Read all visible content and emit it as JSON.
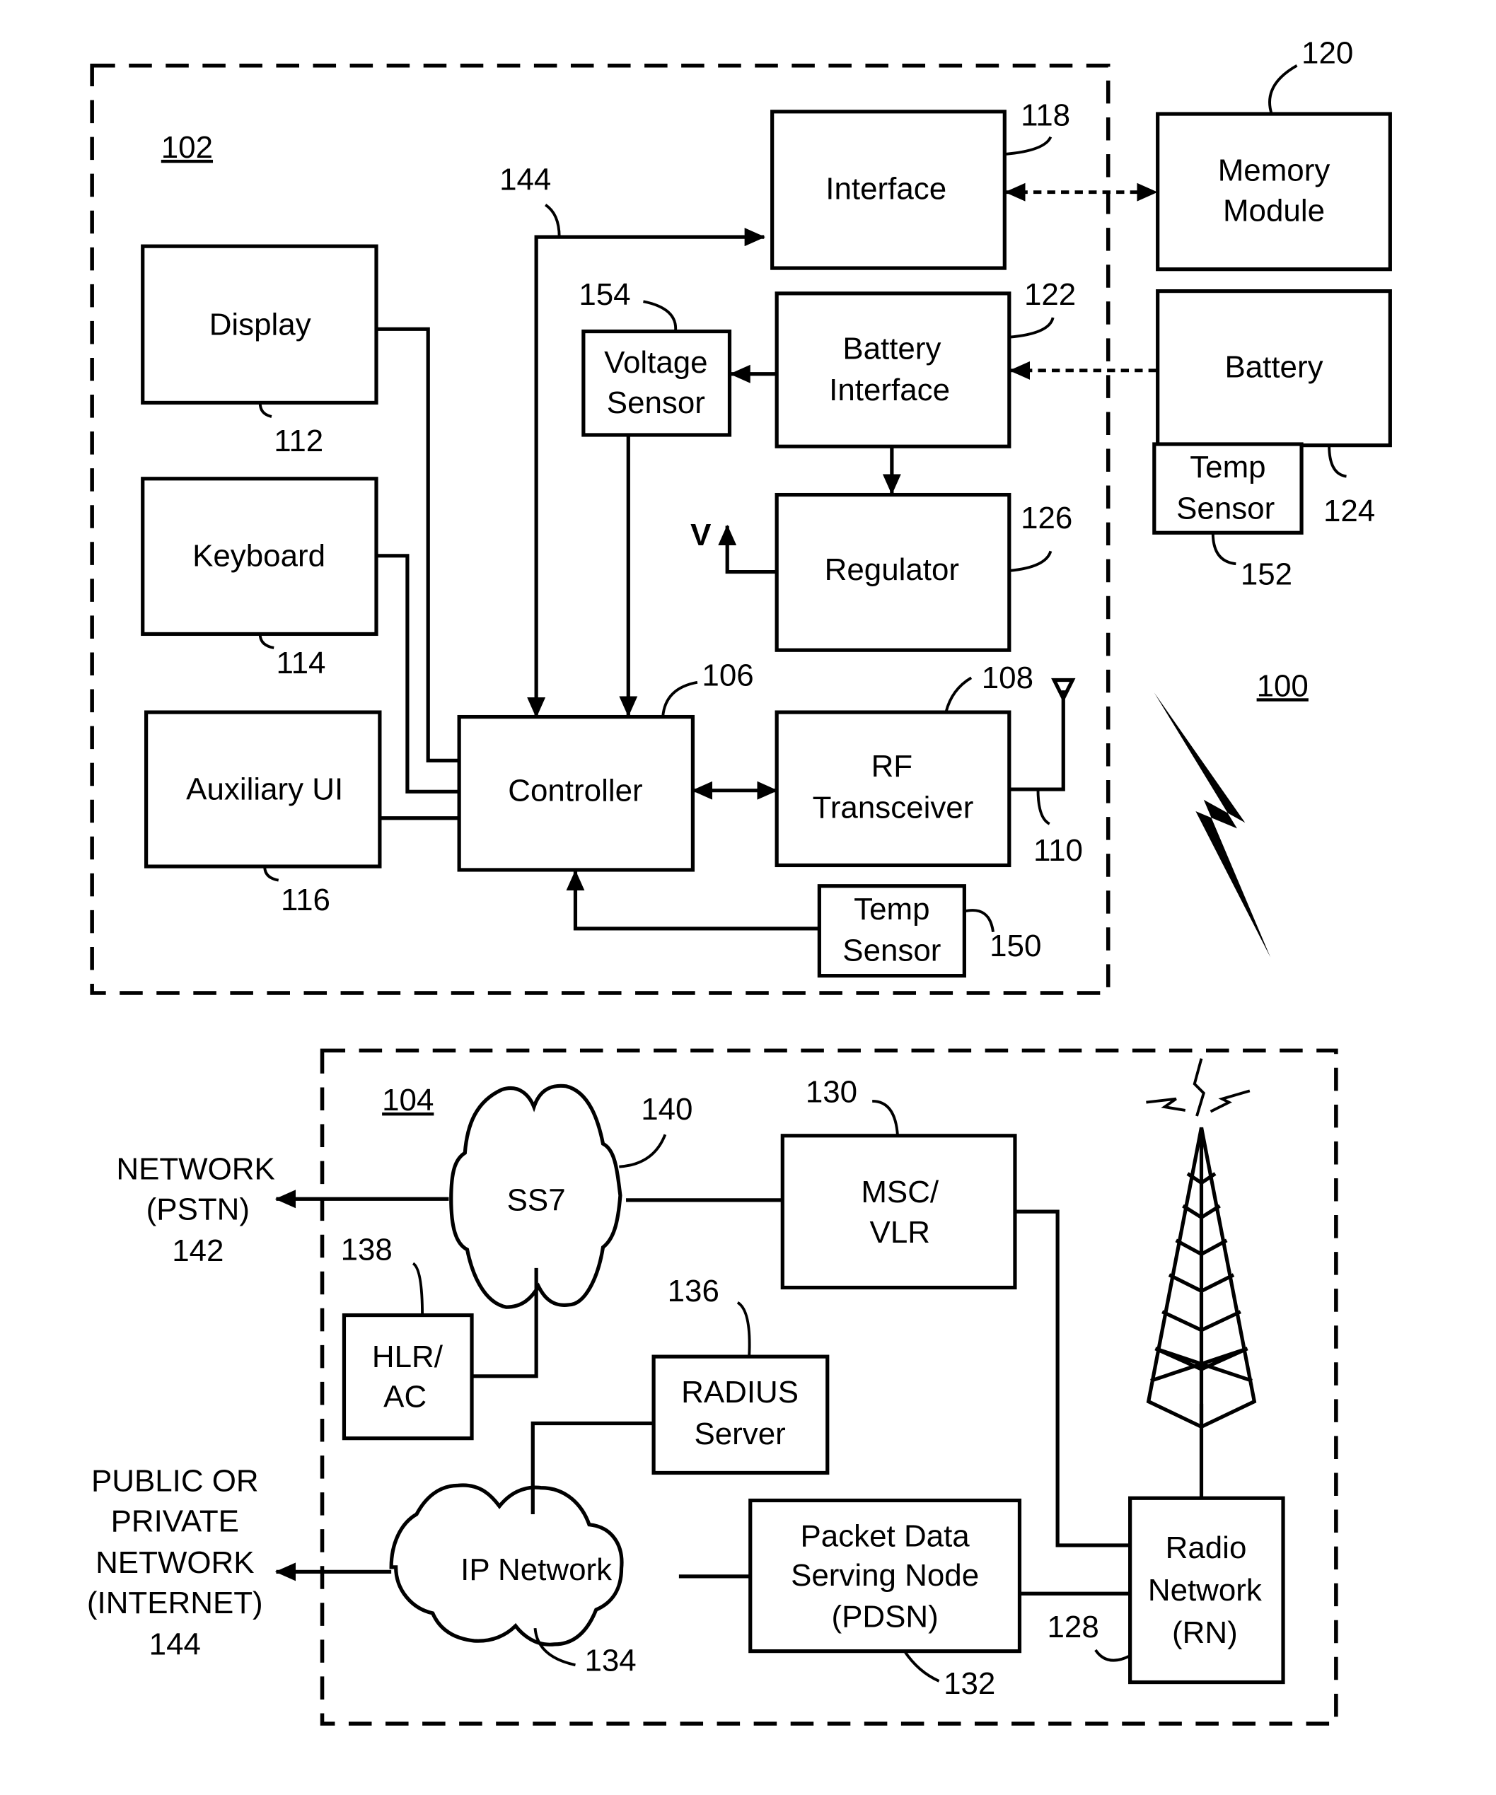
{
  "figure": {
    "device_label": "102",
    "system_label": "100",
    "network_label": "104",
    "device": {
      "display": {
        "label": "Display",
        "ref": "112"
      },
      "keyboard": {
        "label": "Keyboard",
        "ref": "114"
      },
      "auxiliary_ui": {
        "label": "Auxiliary UI",
        "ref": "116"
      },
      "controller": {
        "label": "Controller",
        "ref": "106"
      },
      "interface": {
        "label": "Interface",
        "ref": "118"
      },
      "bus_ref": "144",
      "voltage_sensor": {
        "line1": "Voltage",
        "line2": "Sensor",
        "ref": "154"
      },
      "battery_interface": {
        "line1": "Battery",
        "line2": "Interface",
        "ref": "122"
      },
      "regulator": {
        "label": "Regulator",
        "ref": "126",
        "output": "V"
      },
      "rf_transceiver": {
        "line1": "RF",
        "line2": "Transceiver",
        "ref": "108"
      },
      "antenna_ref": "110",
      "temp_sensor": {
        "line1": "Temp",
        "line2": "Sensor",
        "ref": "150"
      }
    },
    "external": {
      "memory_module": {
        "line1": "Memory",
        "line2": "Module",
        "ref": "120"
      },
      "battery": {
        "label": "Battery",
        "ref": "124"
      },
      "battery_temp_sensor": {
        "line1": "Temp",
        "line2": "Sensor",
        "ref": "152"
      }
    },
    "network": {
      "ss7": {
        "label": "SS7",
        "ref": "140"
      },
      "msc_vlr": {
        "line1": "MSC/",
        "line2": "VLR",
        "ref": "130"
      },
      "hlr_ac": {
        "line1": "HLR/",
        "line2": "AC",
        "ref": "138"
      },
      "radius": {
        "line1": "RADIUS",
        "line2": "Server",
        "ref": "136"
      },
      "ip_network": {
        "label": "IP Network",
        "ref": "134"
      },
      "pdsn": {
        "line1": "Packet Data",
        "line2": "Serving Node",
        "line3": "(PDSN)",
        "ref": "132"
      },
      "radio_network": {
        "line1": "Radio",
        "line2": "Network",
        "line3": "(RN)",
        "ref": "128"
      },
      "pstn": {
        "line1": "NETWORK",
        "line2": "(PSTN)",
        "ref": "142"
      },
      "internet": {
        "line1": "PUBLIC OR",
        "line2": "PRIVATE",
        "line3": "NETWORK",
        "line4": "(INTERNET)",
        "ref": "144"
      }
    }
  }
}
